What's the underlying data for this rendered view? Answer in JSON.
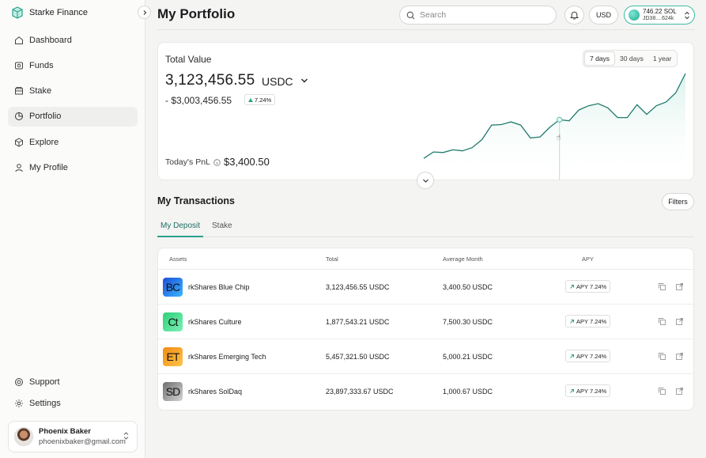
{
  "brand": {
    "name": "Starke Finance"
  },
  "sidebar": {
    "items": [
      {
        "label": "Dashboard",
        "icon": "home-icon"
      },
      {
        "label": "Funds",
        "icon": "funds-icon"
      },
      {
        "label": "Stake",
        "icon": "stake-icon"
      },
      {
        "label": "Portfolio",
        "icon": "pie-chart-icon",
        "active": true
      },
      {
        "label": "Explore",
        "icon": "cube-icon"
      },
      {
        "label": "My Profile",
        "icon": "user-icon"
      }
    ],
    "bottom": [
      {
        "label": "Support",
        "icon": "support-icon"
      },
      {
        "label": "Settings",
        "icon": "gear-icon"
      }
    ],
    "user": {
      "name": "Phoenix Baker",
      "email": "phoenixbaker@gmail.com"
    }
  },
  "header": {
    "title": "My Portfolio",
    "search_placeholder": "Search",
    "currency": "USD",
    "wallet": {
      "balance": "746.22 SOL",
      "address": "JD38....624k"
    }
  },
  "total_value": {
    "label": "Total Value",
    "amount": "3,123,456.55",
    "unit": "USDC",
    "change": "- $3,003,456.55",
    "change_pct": "7.24%",
    "pnl_label": "Today's PnL",
    "pnl_value": "$3,400.50",
    "ranges": [
      "7 days",
      "30 days",
      "1 year"
    ],
    "active_range": "7 days"
  },
  "chart_data": {
    "type": "area",
    "values": [
      10,
      22,
      21,
      26,
      24,
      30,
      45,
      72,
      73,
      78,
      72,
      48,
      50,
      68,
      82,
      80,
      100,
      108,
      112,
      104,
      86,
      86,
      110,
      92,
      108,
      115,
      132,
      168
    ],
    "highlight_index": 14,
    "color": "#1f7b6d"
  },
  "transactions": {
    "title": "My Transactions",
    "filters_label": "Filters",
    "tabs": [
      "My Deposit",
      "Stake"
    ],
    "columns": [
      "Assets",
      "Total",
      "Average Month",
      "APY"
    ],
    "rows": [
      {
        "icon_text": "BC",
        "icon_color": "#2f86e6",
        "name": "rkShares Blue Chip",
        "total": "3,123,456.55 USDC",
        "avg": "3,400.50 USDC",
        "apy": "APY 7.24%"
      },
      {
        "icon_text": "Ct",
        "icon_color": "#2fd37f",
        "name": "rkShares Culture",
        "total": "1,877,543.21 USDC",
        "avg": "7,500.30 USDC",
        "apy": "APY 7.24%"
      },
      {
        "icon_text": "ET",
        "icon_color": "#f29a1b",
        "name": "rkShares Emerging Tech",
        "total": "5,457,321.50 USDC",
        "avg": "5,000.21 USDC",
        "apy": "APY 7.24%"
      },
      {
        "icon_text": "SD",
        "icon_color": "#9a9a9a",
        "name": "rkShares SolDaq",
        "total": "23,897,333.67 USDC",
        "avg": "1,000.67 USDC",
        "apy": "APY 7.24%"
      }
    ]
  },
  "colors": {
    "accent": "#2aa18d",
    "positive": "#2fa37a"
  }
}
